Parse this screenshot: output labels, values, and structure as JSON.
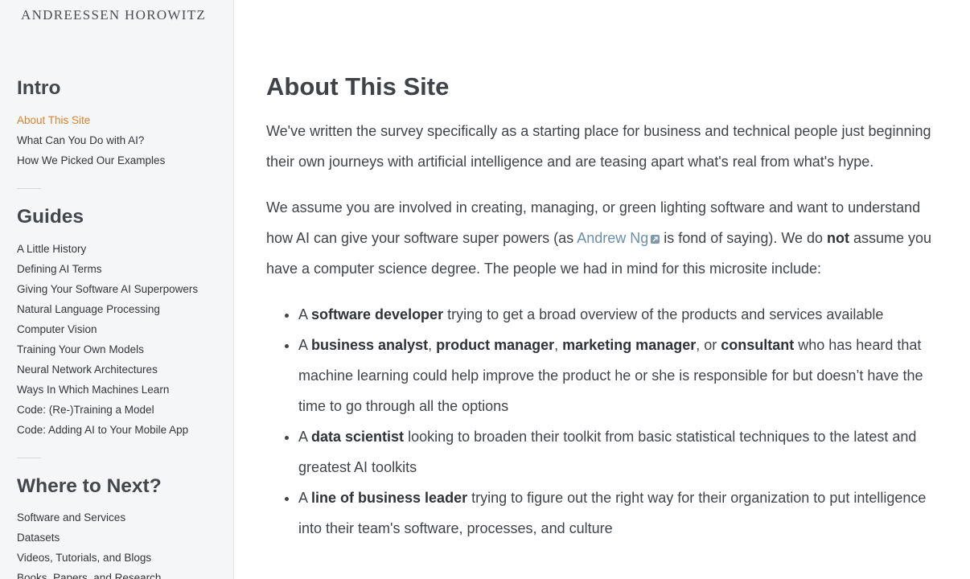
{
  "sidebar": {
    "logo": "ANDREESSEN HOROWITZ",
    "sections": [
      {
        "heading": "Intro",
        "items": [
          "About This Site",
          "What Can You Do with AI?",
          "How We Picked Our Examples"
        ]
      },
      {
        "heading": "Guides",
        "items": [
          "A Little History",
          "Defining AI Terms",
          "Giving Your Software AI Superpowers",
          "Natural Language Processing",
          "Computer Vision",
          "Training Your Own Models",
          "Neural Network Architectures",
          "Ways In Which Machines Learn",
          "Code: (Re-)Training a Model",
          "Code: Adding AI to Your Mobile App"
        ]
      },
      {
        "heading": "Where to Next?",
        "items": [
          "Software and Services",
          "Datasets",
          "Videos, Tutorials, and Blogs",
          "Books, Papers, and Research"
        ]
      }
    ],
    "active_item": "About This Site"
  },
  "main": {
    "title": "About This Site",
    "para1": "We've written the survey specifically as a starting place for business and technical people just beginning their own journeys with artificial intelligence and are teasing apart what's real from what's hype.",
    "para2": {
      "before_link": "We assume you are involved in creating, managing, or green lighting software and want to understand how AI can give your software super powers (as ",
      "link": "Andrew Ng",
      "after_link": " is fond of saying). We do ",
      "emphasis": "not",
      "end": " assume you have a computer science degree. The people we had in mind for this microsite include:"
    },
    "bullets": [
      {
        "pre": "A ",
        "b1": "software developer",
        "rest": " trying to get a broad overview of the products and services available"
      },
      {
        "pre": "A ",
        "b1": "business analyst",
        "sep1": ", ",
        "b2": "product manager",
        "sep2": ", ",
        "b3": "marketing manager",
        "sep3": ", or ",
        "b4": "consultant",
        "rest": " who has heard that machine learning could help improve the product he or she is responsible for but doesn’t have the time to go through all the options"
      },
      {
        "pre": "A ",
        "b1": "data scientist",
        "rest": " looking to broaden their toolkit from basic statistical techniques to the latest and greatest AI toolkits"
      },
      {
        "pre": "A ",
        "b1": "line of business leader",
        "rest": " trying to figure out the right way for their organization to put intelligence into their team's software, processes, and culture"
      }
    ]
  },
  "colors": {
    "active_nav": "#d9832e",
    "link": "#6b8fa8",
    "sidebar_bg": "#f5f6f8"
  }
}
